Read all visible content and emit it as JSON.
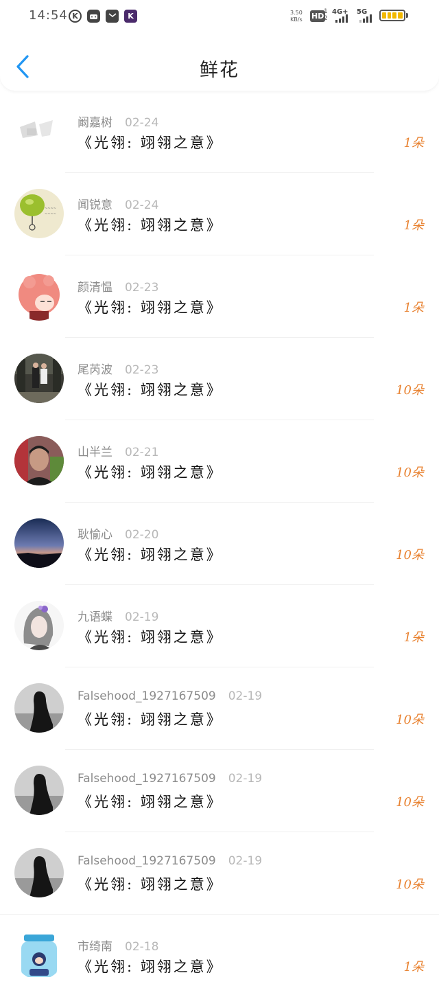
{
  "status_bar": {
    "time": "14:54",
    "net_speed_value": "3.50",
    "net_speed_unit": "KB/s",
    "hd_label": "HD",
    "hd_sub": "1 2",
    "sig1_label": "4G+",
    "sig2_label": "5G",
    "icons": [
      "k-circle-icon",
      "game-icon",
      "mail-icon",
      "k-app-icon"
    ]
  },
  "header": {
    "title": "鲜花",
    "back_icon": "chevron-left-icon",
    "accent_color": "#2196f3"
  },
  "colors": {
    "count": "#e8812f"
  },
  "rows": [
    {
      "name": "阚嘉树",
      "date": "02-24",
      "gift": "《光翎: 翊翎之意》",
      "count": "1朵",
      "avatar": "faded-logo"
    },
    {
      "name": "闻锐意",
      "date": "02-24",
      "gift": "《光翎: 翊翎之意》",
      "count": "1朵",
      "avatar": "lime-drawing"
    },
    {
      "name": "颜清愠",
      "date": "02-23",
      "gift": "《光翎: 翊翎之意》",
      "count": "1朵",
      "avatar": "pink-hair-girl"
    },
    {
      "name": "尾芮波",
      "date": "02-23",
      "gift": "《光翎: 翊翎之意》",
      "count": "10朵",
      "avatar": "couple-photo"
    },
    {
      "name": "山半兰",
      "date": "02-21",
      "gift": "《光翎: 翊翎之意》",
      "count": "10朵",
      "avatar": "selfie"
    },
    {
      "name": "耿愉心",
      "date": "02-20",
      "gift": "《光翎: 翊翎之意》",
      "count": "10朵",
      "avatar": "dusk-sky"
    },
    {
      "name": "九语蝶",
      "date": "02-19",
      "gift": "《光翎: 翊翎之意》",
      "count": "1朵",
      "avatar": "anime-girl"
    },
    {
      "name": "Falsehood_1927167509",
      "date": "02-19",
      "gift": "《光翎: 翊翎之意》",
      "count": "10朵",
      "avatar": "silhouette"
    },
    {
      "name": "Falsehood_1927167509",
      "date": "02-19",
      "gift": "《光翎: 翊翎之意》",
      "count": "10朵",
      "avatar": "silhouette"
    },
    {
      "name": "Falsehood_1927167509",
      "date": "02-19",
      "gift": "《光翎: 翊翎之意》",
      "count": "10朵",
      "avatar": "silhouette"
    },
    {
      "name": "市绮南",
      "date": "02-18",
      "gift": "《光翎: 翊翎之意》",
      "count": "1朵",
      "avatar": "jar-character"
    }
  ]
}
